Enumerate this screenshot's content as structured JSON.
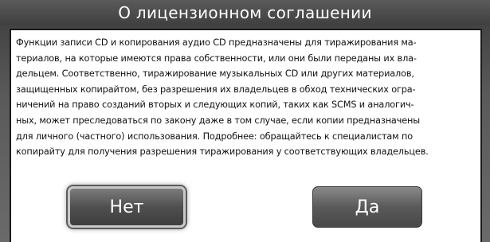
{
  "dialog": {
    "title": "О лицензионном соглашении",
    "message": "Функции записи CD и копирования аудио CD предназначены для тиражирования ма-\nтериалов, на которые имеются права собственности, или они были переданы их вла-\nдельцем. Соответственно, тиражирование музыкальных CD или других материалов,\nзащищенных копирайтом, без разрешения их владельцев в обход технических огра-\nничений на право созданий вторых и следующих копий, таких как SCMS и аналогич-\nных, может преследоваться по закону даже в том случае, если копии предназначены\nдля личного (частного) использования. Подробнее: обращайтесь к специалистам по\nкопирайту для получения разрешения тиражирования у соответствующих владельцев.",
    "buttons": {
      "no_label": "Нет",
      "yes_label": "Да"
    }
  }
}
